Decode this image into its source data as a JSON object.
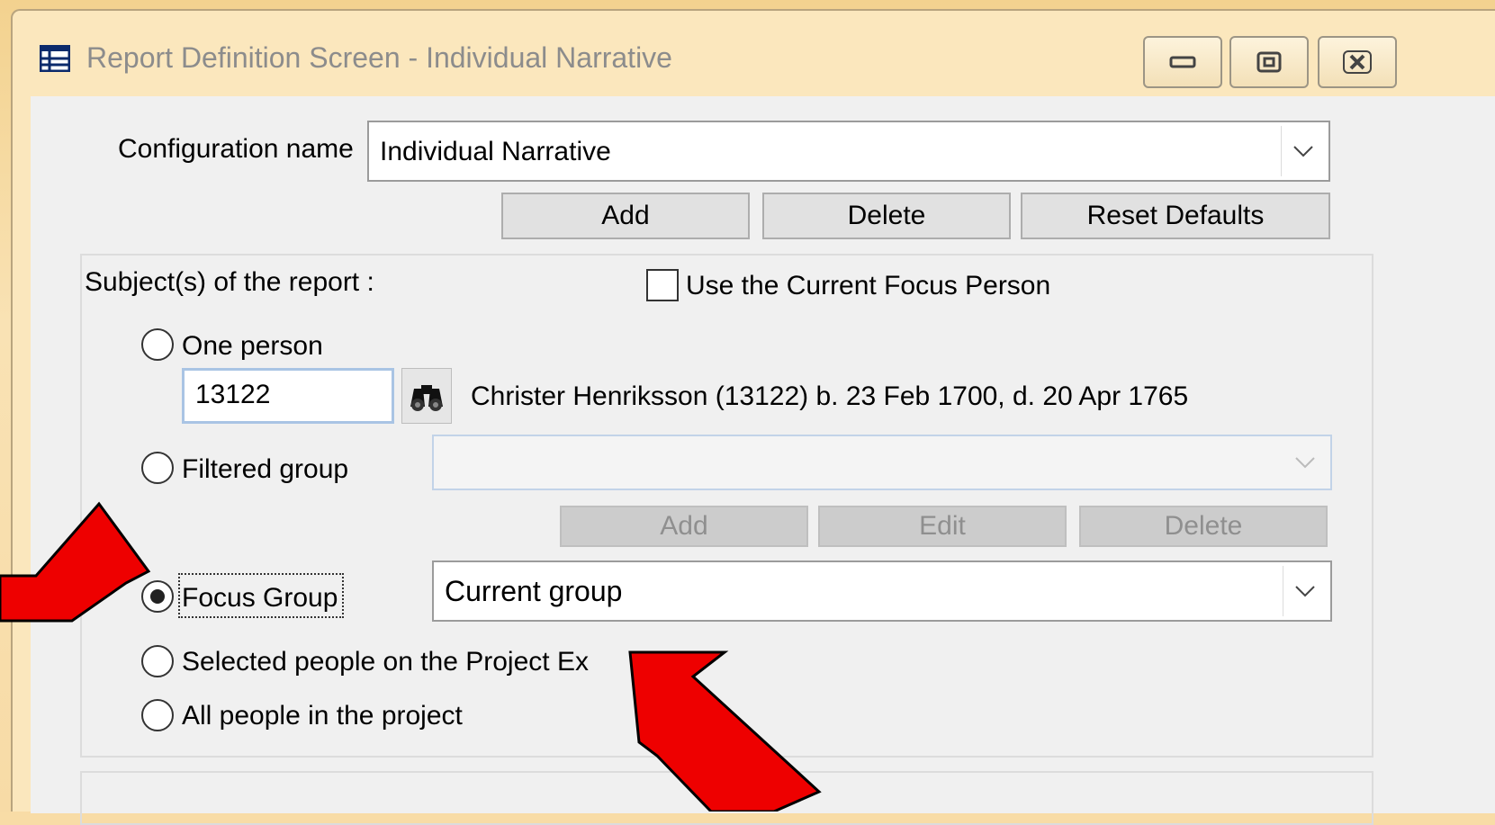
{
  "window": {
    "title": "Report Definition Screen - Individual Narrative",
    "app_icon": "grid-window-icon",
    "minimize_icon": "minimize-icon",
    "restore_icon": "restore-icon",
    "close_icon": "close-icon"
  },
  "config": {
    "label": "Configuration name",
    "selected": "Individual Narrative",
    "add": "Add",
    "delete": "Delete",
    "reset": "Reset Defaults"
  },
  "subjects": {
    "heading": "Subject(s) of the report :",
    "use_focus_label": "Use the Current Focus Person",
    "use_focus_checked": false,
    "one_person_label": "One person",
    "person_id": "13122",
    "person_desc": "Christer Henriksson (13122) b. 23 Feb 1700, d. 20 Apr 1765",
    "filtered_group_label": "Filtered group",
    "filtered_group_value": "",
    "filter_add": "Add",
    "filter_edit": "Edit",
    "filter_delete": "Delete",
    "focus_group_label": "Focus Group",
    "focus_group_value": "Current group",
    "selected_people_label": "Selected people on the Project Ex",
    "all_people_label": "All people in the project",
    "selected_option": "focus_group"
  },
  "annotations": {
    "arrow_color": "#ee0000"
  }
}
